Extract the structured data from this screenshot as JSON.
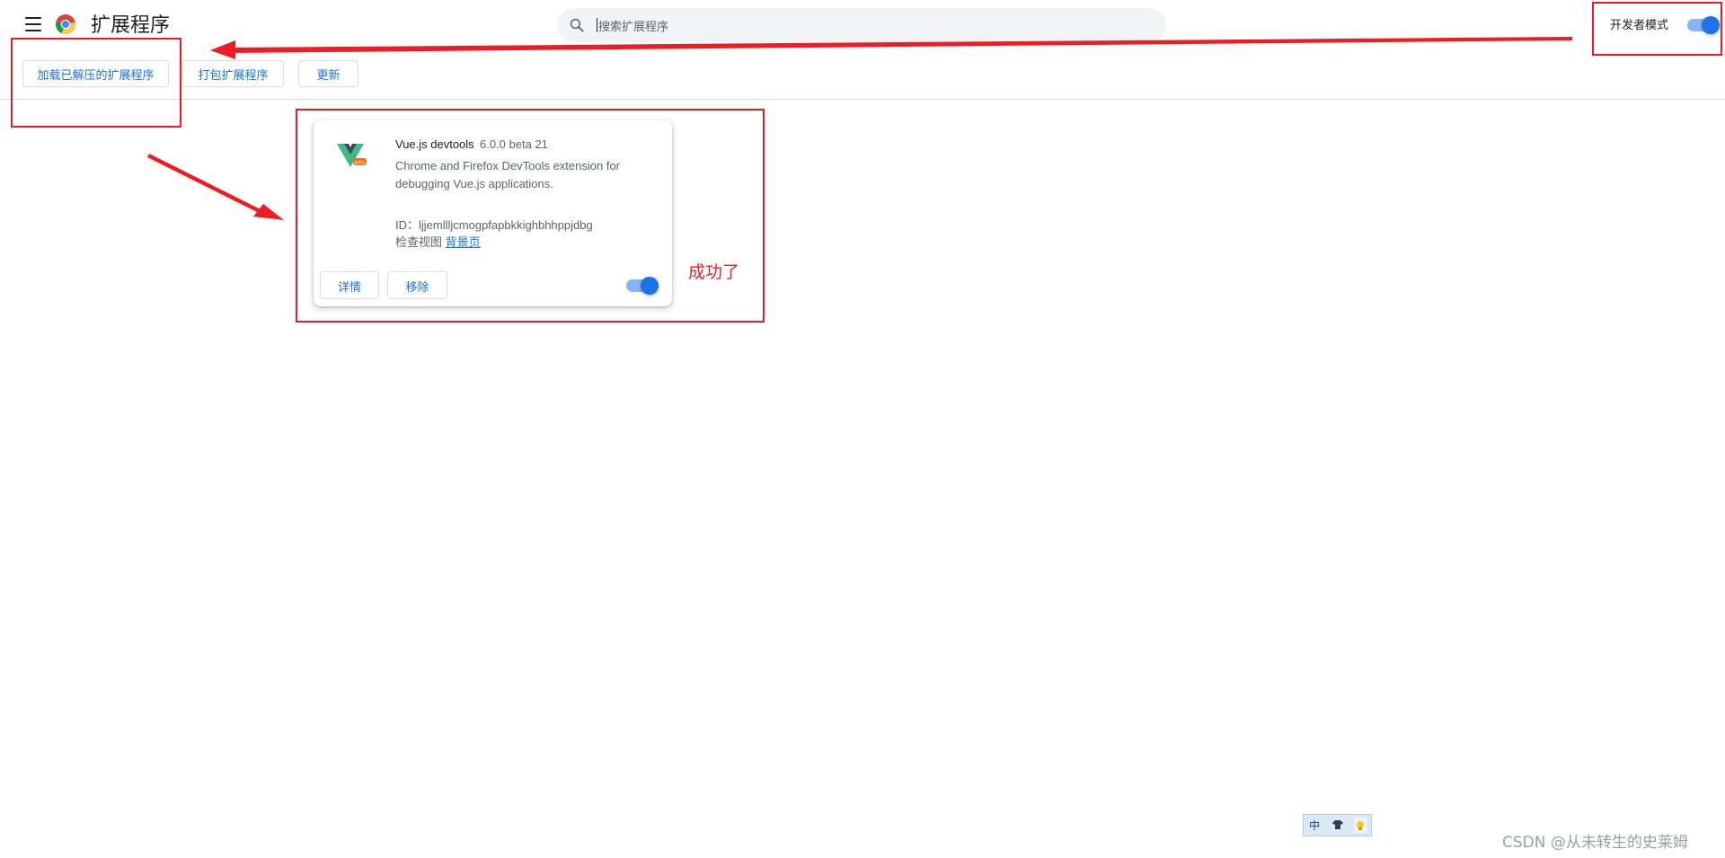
{
  "header": {
    "title": "扩展程序",
    "search_placeholder": "搜索扩展程序",
    "dev_mode_label": "开发者模式",
    "dev_mode_enabled": true
  },
  "toolbar": {
    "load_unpacked": "加载已解压的扩展程序",
    "pack_extension": "打包扩展程序",
    "update": "更新"
  },
  "extensions": [
    {
      "name": "Vue.js devtools",
      "version": "6.0.0 beta 21",
      "description": "Chrome and Firefox DevTools extension for debugging Vue.js applications.",
      "id_label": "ID：",
      "id": "ljjemllljcmogpfapbkkighbhhppjdbg",
      "inspect_label": "检查视图",
      "inspect_link": "背景页",
      "details_button": "详情",
      "remove_button": "移除",
      "enabled": true
    }
  ],
  "annotations": {
    "success_text": "成功了",
    "color": "#ee1c24"
  },
  "ime": {
    "mode": "中"
  },
  "watermark": "CSDN @从未转生的史莱姆",
  "colors": {
    "accent": "#1a73e8",
    "toggle_track": "#8ab4f8",
    "vue_green": "#42b883",
    "vue_dark": "#35495e",
    "beta_badge": "#f37021"
  },
  "icons": [
    "menu-icon",
    "chrome-logo-icon",
    "search-icon",
    "vue-logo-icon"
  ]
}
